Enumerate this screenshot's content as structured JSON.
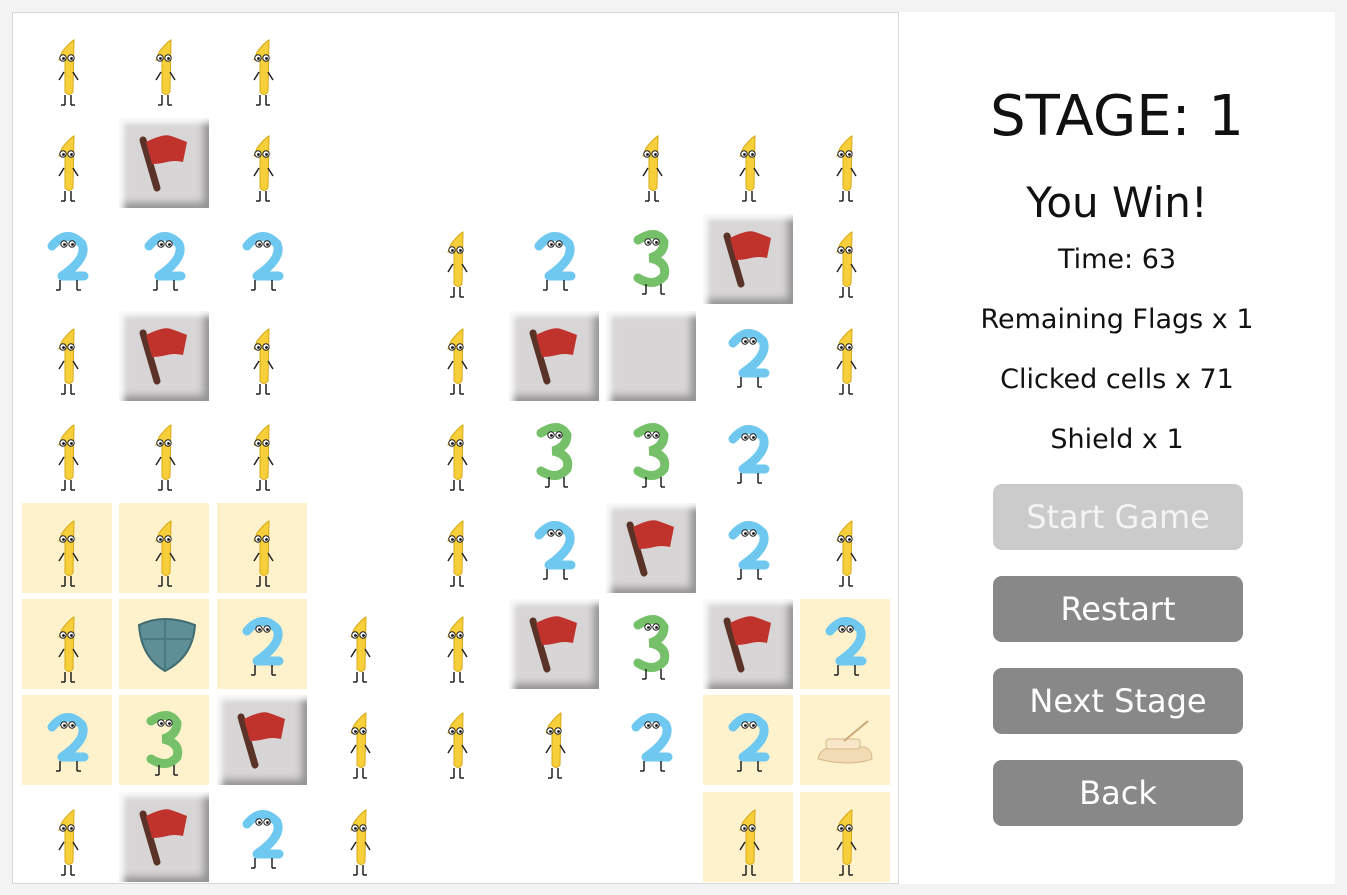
{
  "panel": {
    "stage": "STAGE: 1",
    "result": "You Win!",
    "time": "Time: 63",
    "flags": "Remaining Flags x 1",
    "clicked": "Clicked cells x 71",
    "shield": "Shield x 1"
  },
  "buttons": {
    "start": "Start Game",
    "restart": "Restart",
    "next": "Next Stage",
    "back": "Back"
  },
  "colors": {
    "one": "#f7cf3a",
    "two": "#6fc8f0",
    "three": "#77c06a",
    "flag": "#c0322c",
    "highlight": "#fdf2cc"
  },
  "board": {
    "rows": 9,
    "cols": 9,
    "cells": [
      [
        "1",
        "1",
        "1",
        "",
        "",
        "",
        "",
        "",
        ""
      ],
      [
        "1",
        "F",
        "1",
        "",
        "",
        "",
        "1",
        "1",
        "1"
      ],
      [
        "2",
        "2",
        "2",
        "",
        "1",
        "2",
        "3",
        "F",
        "1"
      ],
      [
        "1",
        "F",
        "1",
        "",
        "1",
        "F",
        "C",
        "2",
        "1"
      ],
      [
        "1",
        "1",
        "1",
        "",
        "1",
        "3",
        "3",
        "2",
        ""
      ],
      [
        "1h",
        "1h",
        "1h",
        "",
        "1",
        "2",
        "F",
        "2",
        "1"
      ],
      [
        "1h",
        "Sh",
        "2h",
        "1",
        "1",
        "F",
        "3",
        "F",
        "2h"
      ],
      [
        "2h",
        "3h",
        "F",
        "1",
        "1",
        "1",
        "2",
        "2h",
        "Bh"
      ],
      [
        "1",
        "F",
        "2",
        "1",
        "",
        "",
        "",
        "1h",
        "1h"
      ]
    ]
  }
}
